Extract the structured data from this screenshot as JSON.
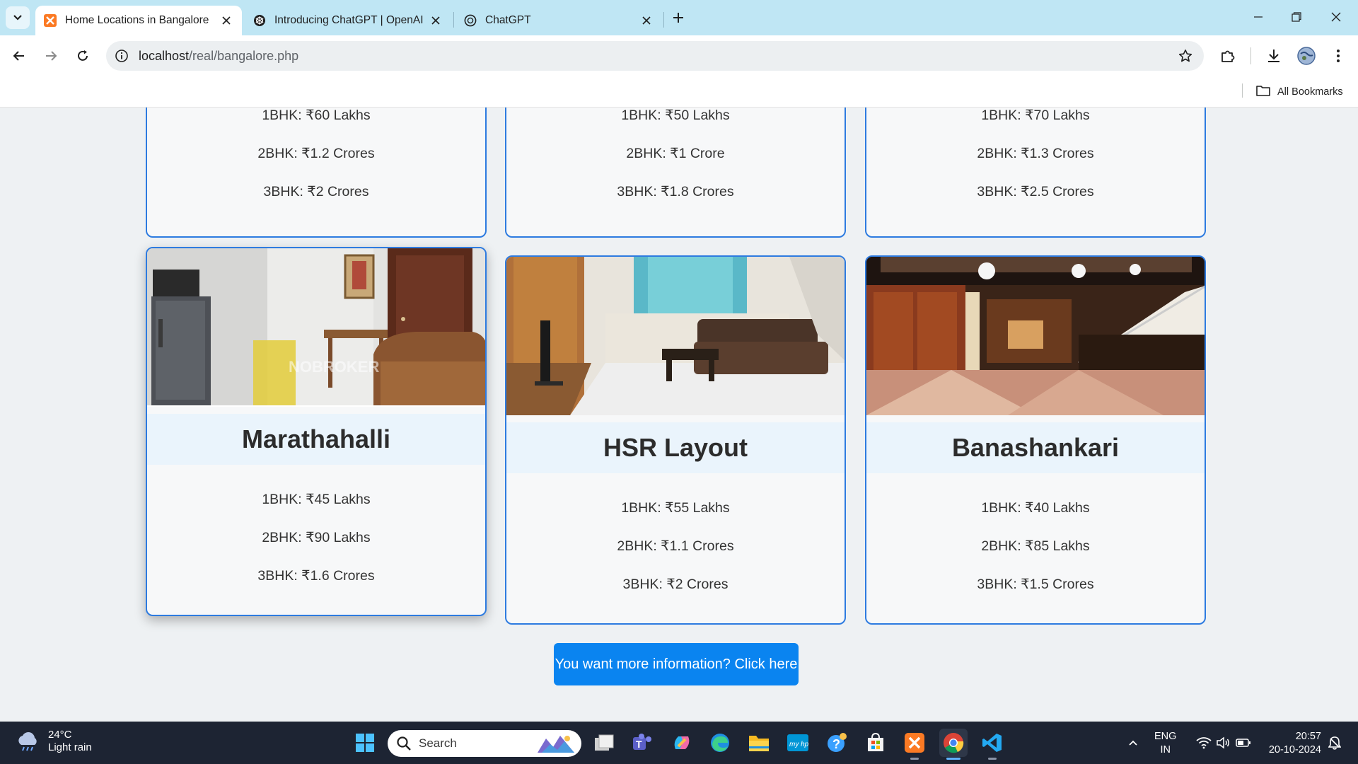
{
  "browser": {
    "tabs": [
      {
        "title": "Home Locations in Bangalore",
        "active": true,
        "favicon": "xampp-icon"
      },
      {
        "title": "Introducing ChatGPT | OpenAI",
        "active": false,
        "favicon": "openai-icon"
      },
      {
        "title": "ChatGPT",
        "active": false,
        "favicon": "openai-icon"
      }
    ],
    "url_host": "localhost",
    "url_path": "/real/bangalore.php",
    "bookmarks_label": "All Bookmarks"
  },
  "top_cards": [
    {
      "prices": [
        "1BHK: ₹60 Lakhs",
        "2BHK: ₹1.2 Crores",
        "3BHK: ₹2 Crores"
      ]
    },
    {
      "prices": [
        "1BHK: ₹50 Lakhs",
        "2BHK: ₹1 Crore",
        "3BHK: ₹1.8 Crores"
      ]
    },
    {
      "prices": [
        "1BHK: ₹70 Lakhs",
        "2BHK: ₹1.3 Crores",
        "3BHK: ₹2.5 Crores"
      ]
    }
  ],
  "cards": [
    {
      "name": "Marathahalli",
      "prices": [
        "1BHK: ₹45 Lakhs",
        "2BHK: ₹90 Lakhs",
        "3BHK: ₹1.6 Crores"
      ],
      "watermark": "NOBROKER"
    },
    {
      "name": "HSR Layout",
      "prices": [
        "1BHK: ₹55 Lakhs",
        "2BHK: ₹1.1 Crores",
        "3BHK: ₹2 Crores"
      ]
    },
    {
      "name": "Banashankari",
      "prices": [
        "1BHK: ₹40 Lakhs",
        "2BHK: ₹85 Lakhs",
        "3BHK: ₹1.5 Crores"
      ]
    }
  ],
  "cta_label": "You want more information? Click here",
  "taskbar": {
    "weather_temp": "24°C",
    "weather_desc": "Light rain",
    "search_placeholder": "Search",
    "lang_line1": "ENG",
    "lang_line2": "IN",
    "time": "20:57",
    "date": "20-10-2024"
  },
  "colors": {
    "card_border": "#2d7be0",
    "cta_bg": "#0a84f0",
    "tabstrip": "#bfe6f4",
    "taskbar": "#1d2433"
  }
}
